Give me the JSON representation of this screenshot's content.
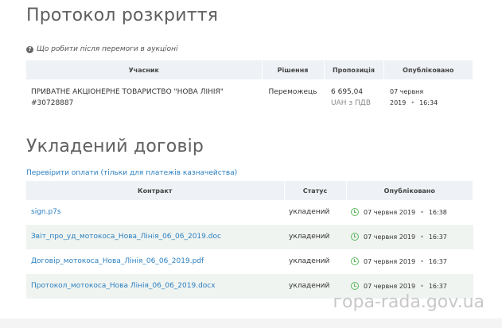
{
  "protocol": {
    "title": "Протокол розкриття",
    "help": "Що робити після перемоги в аукціоні",
    "headers": [
      "Учасник",
      "Рішення",
      "Пропозиція",
      "Опубліковано"
    ],
    "row": {
      "participant": "ПРИВАТНЕ АКЦІОНЕРНЕ ТОВАРИСТВО \"НОВА ЛІНІЯ\" #30728887",
      "decision": "Переможець",
      "amount": "6 695,04",
      "amount_sub": "UAH з ПДВ",
      "date": "07 червня 2019",
      "time": "16:34"
    }
  },
  "contract": {
    "title": "Укладений договір",
    "check_link": "Перевірити оплати (тільки для платежів казначейства)",
    "headers": [
      "Контракт",
      "Статус",
      "Опубліковано"
    ],
    "rows": [
      {
        "file": "sign.p7s",
        "status": "укладений",
        "date": "07 червня 2019",
        "time": "16:38"
      },
      {
        "file": "Звіт_про_уд_мотокоса_Нова_Лінія_06_06_2019.doc",
        "status": "укладений",
        "date": "07 червня 2019",
        "time": "16:37"
      },
      {
        "file": "Договір_мотокоса_Нова_Лінія_06_06_2019.pdf",
        "status": "укладений",
        "date": "07 червня 2019",
        "time": "16:37"
      },
      {
        "file": "Протокол_мотокоса_Нова Лінія_06_06_2019.docx",
        "status": "укладений",
        "date": "07 червня 2019",
        "time": "16:37"
      }
    ]
  },
  "watermark": "гора-rada.gov.ua",
  "colors": {
    "link": "#2a7fc1",
    "clock": "#5cb85c",
    "header_bg": "#eef1f5",
    "row_alt_bg": "#f0f4f0"
  }
}
